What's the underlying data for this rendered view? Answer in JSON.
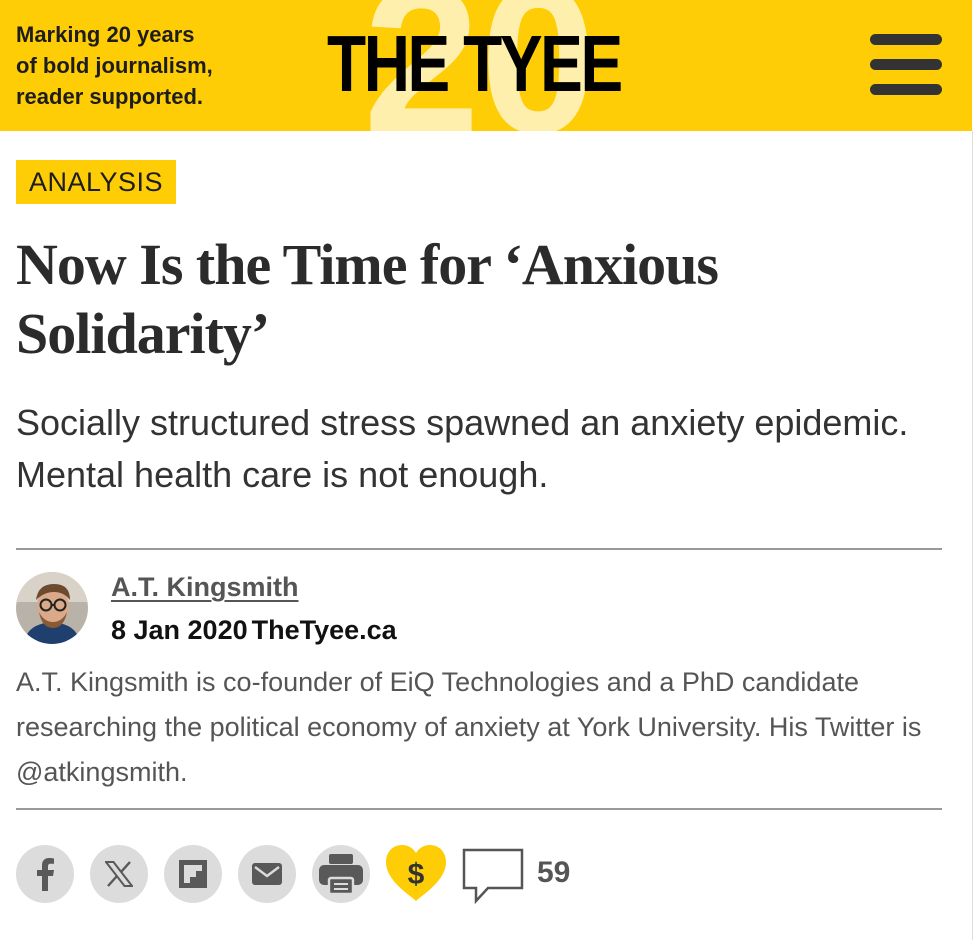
{
  "header": {
    "tagline_lines": [
      "Marking 20 years",
      "of bold journalism,",
      "reader supported."
    ],
    "logo": "THE TYEE",
    "background_numeral": "20",
    "brand_color": "#ffcd05",
    "menu_icon": "hamburger-menu-icon"
  },
  "article": {
    "section_tag": "ANALYSIS",
    "headline": "Now Is the Time for ‘Anxious Solidarity’",
    "dek": "Socially structured stress spawned an anxiety epidemic. Mental health care is not enough."
  },
  "byline": {
    "author": "A.T. Kingsmith",
    "date": "8 Jan 2020",
    "site": "TheTyee.ca",
    "bio": "A.T. Kingsmith is co-founder of EiQ Technologies and a PhD candidate researching the political economy of anxiety at York University. His Twitter is @atkingsmith."
  },
  "share": {
    "icons": [
      "facebook-icon",
      "x-icon",
      "flipboard-icon",
      "email-icon",
      "print-icon",
      "donate-heart-icon",
      "comment-icon"
    ],
    "comment_count": "59"
  }
}
